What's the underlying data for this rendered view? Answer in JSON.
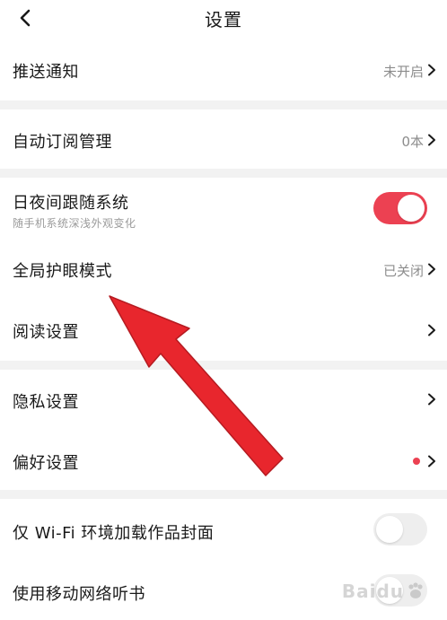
{
  "header": {
    "title": "设置",
    "back_icon": "chevron-left-icon"
  },
  "rows": {
    "push": {
      "label": "推送通知",
      "value": "未开启"
    },
    "auto_subscribe": {
      "label": "自动订阅管理",
      "value": "0本"
    },
    "night_follow": {
      "label": "日夜间跟随系统",
      "sub": "随手机系统深浅外观变化",
      "toggle": "on"
    },
    "eye_care": {
      "label": "全局护眼模式",
      "value": "已关闭"
    },
    "reading": {
      "label": "阅读设置"
    },
    "privacy": {
      "label": "隐私设置"
    },
    "preference": {
      "label": "偏好设置",
      "badge": "red-dot"
    },
    "wifi_cover": {
      "label": "仅 Wi-Fi 环境加载作品封面",
      "toggle": "off"
    },
    "mobile_listen": {
      "label": "使用移动网络听书",
      "toggle": "off"
    }
  },
  "colors": {
    "accent": "#ec4152",
    "separator": "#f2f2f2",
    "annotation_arrow": "#e8262d"
  },
  "watermark": {
    "text": "Baidu"
  }
}
